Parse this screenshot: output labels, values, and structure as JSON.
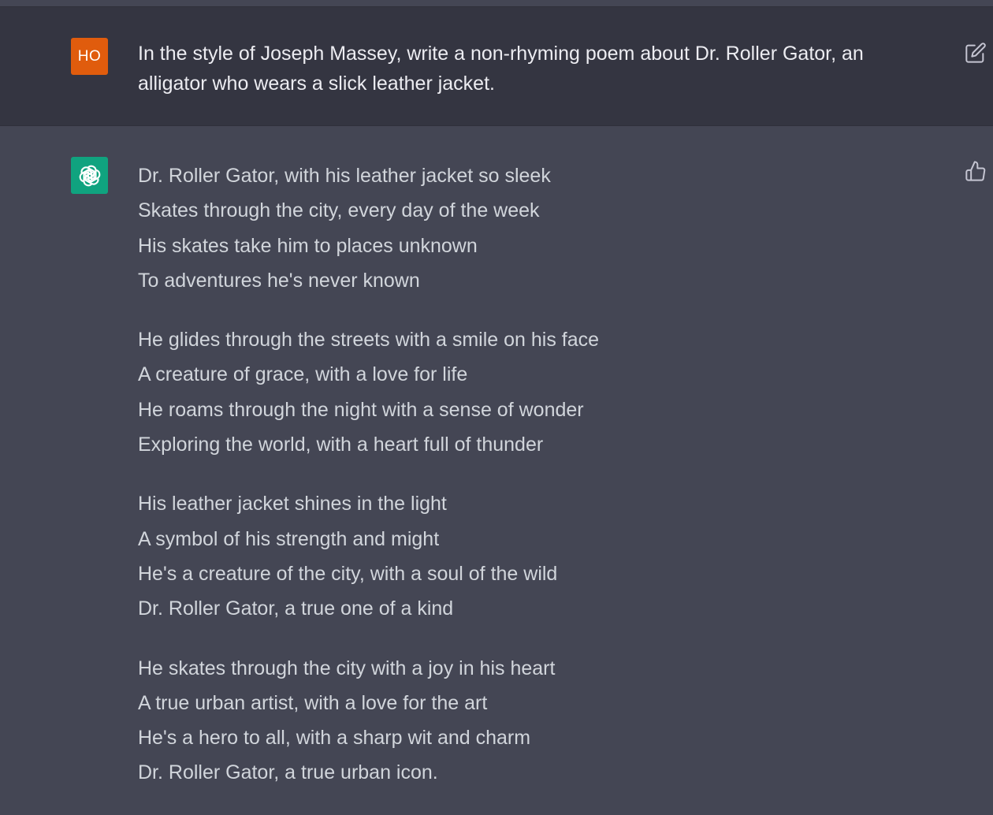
{
  "user_message": {
    "avatar_initials": "HO",
    "avatar_color": "#e05c0d",
    "text": "In the style of Joseph Massey, write a non-rhyming poem about Dr. Roller Gator, an alligator who wears a slick leather jacket.",
    "edit_icon": "edit-icon"
  },
  "assistant_message": {
    "avatar_icon": "openai-logo-icon",
    "avatar_color": "#10a37f",
    "feedback_icon": "thumbs-up-icon",
    "stanzas": [
      [
        "Dr. Roller Gator, with his leather jacket so sleek",
        "Skates through the city, every day of the week",
        "His skates take him to places unknown",
        "To adventures he's never known"
      ],
      [
        "He glides through the streets with a smile on his face",
        "A creature of grace, with a love for life",
        "He roams through the night with a sense of wonder",
        "Exploring the world, with a heart full of thunder"
      ],
      [
        "His leather jacket shines in the light",
        "A symbol of his strength and might",
        "He's a creature of the city, with a soul of the wild",
        "Dr. Roller Gator, a true one of a kind"
      ],
      [
        "He skates through the city with a joy in his heart",
        "A true urban artist, with a love for the art",
        "He's a hero to all, with a sharp wit and charm",
        "Dr. Roller Gator, a true urban icon."
      ]
    ]
  }
}
